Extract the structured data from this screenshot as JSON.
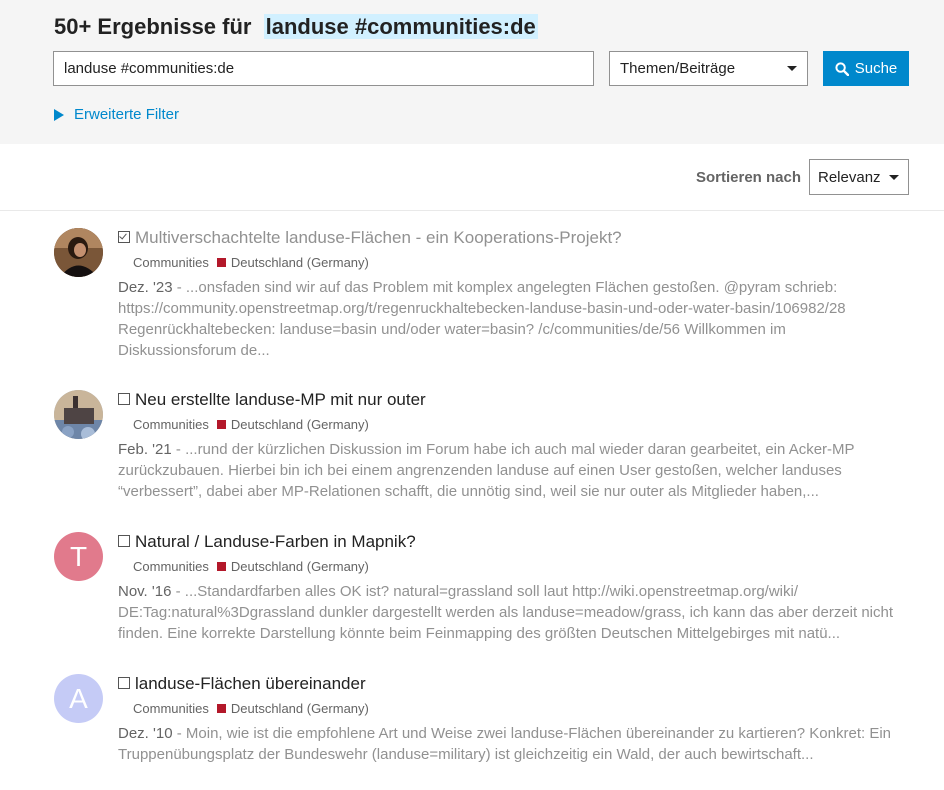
{
  "header": {
    "results_count": "50+ Ergebnisse für",
    "search_term": "landuse #communities:de",
    "search_input_value": "landuse #communities:de",
    "type_select": "Themen/Beiträge",
    "search_button": "Suche",
    "advanced_filter": "Erweiterte Filter"
  },
  "sort": {
    "label": "Sortieren nach",
    "selected": "Relevanz"
  },
  "results": [
    {
      "title": "Multiverschachtelte landuse-Flächen - ein Kooperations-Projekt?",
      "visited": true,
      "category": "Communities",
      "subcategory": "Deutschland (Germany)",
      "date": "Dez. '23",
      "blurb": " - ...onsfaden sind wir auf das Problem mit komplex angelegten Flächen gestoßen. @pyram schrieb: https://community.openstreetmap.org/t/regenruckhaltebecken-landuse-basin-und-oder-water-basin/106982/28 Regenrückhaltebecken: landuse=basin und/oder water=basin? /c/communities/de/56 Willkommen im Diskussionsforum de..."
    },
    {
      "title": "Neu erstellte landuse-MP mit nur outer",
      "visited": false,
      "category": "Communities",
      "subcategory": "Deutschland (Germany)",
      "date": "Feb. '21",
      "blurb": " - ...rund der kürzlichen Diskussion im Forum habe ich auch mal wieder daran gearbeitet, ein Acker-MP zurückzubauen. Hierbei bin ich bei einem angrenzenden landuse auf einen User gestoßen, welcher landuses “verbessert”, dabei aber MP-Relationen schafft, die unnötig sind, weil sie nur outer als Mitglieder haben,..."
    },
    {
      "title": "Natural / Landuse-Farben in Mapnik?",
      "visited": false,
      "avatar_letter": "T",
      "avatar_color": "#e17a8c",
      "category": "Communities",
      "subcategory": "Deutschland (Germany)",
      "date": "Nov. '16",
      "blurb": " - ...Standardfarben alles OK ist? natural=grassland soll laut http://wiki.openstreetmap.org/wiki/ DE:Tag:natural%3Dgrassland dunkler dargestellt werden als landuse=meadow/grass, ich kann das aber derzeit nicht finden. Eine korrekte Darstellung könnte beim Feinmapping des größten Deutschen Mittelgebirges mit natü..."
    },
    {
      "title": "landuse-Flächen übereinander",
      "visited": false,
      "avatar_letter": "A",
      "avatar_color": "#c5cbf6",
      "category": "Communities",
      "subcategory": "Deutschland (Germany)",
      "date": "Dez. '10",
      "blurb": " - Moin, wie ist die empfohlene Art und Weise zwei landuse-Flächen übereinander zu kartieren? Konkret: Ein Truppenübungsplatz der Bundeswehr (landuse=military) ist gleichzeitig ein Wald, der auch bewirtschaft..."
    }
  ],
  "colors": {
    "accent": "#0088cc",
    "tag": "#b3182a",
    "highlight": "#d1f0ff"
  }
}
